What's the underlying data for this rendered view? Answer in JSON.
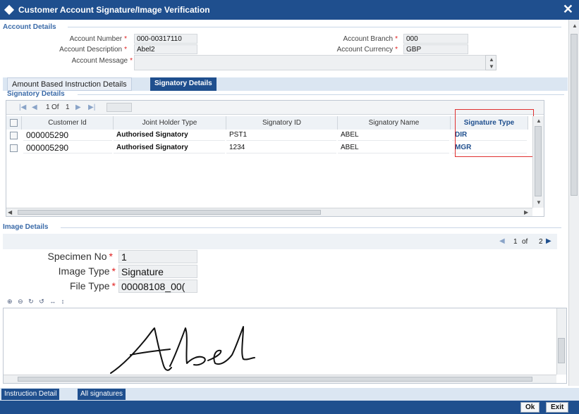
{
  "window": {
    "title": "Customer Account Signature/Image Verification"
  },
  "account_details": {
    "section_label": "Account Details",
    "account_number_label": "Account Number",
    "account_number": "000-00317110",
    "account_description_label": "Account Description",
    "account_description": "Abel2",
    "account_message_label": "Account Message",
    "account_message": "",
    "account_branch_label": "Account Branch",
    "account_branch": "000",
    "account_currency_label": "Account Currency",
    "account_currency": "GBP"
  },
  "tabs": [
    {
      "label": "Amount Based Instruction Details"
    },
    {
      "label": "Signatory Details"
    }
  ],
  "signatory": {
    "section_label": "Signatory Details",
    "pager": {
      "current": "1",
      "of_label": "Of",
      "total": "1"
    },
    "columns": [
      "Customer Id",
      "Joint Holder Type",
      "Signatory ID",
      "Signatory Name",
      "Signature Type"
    ],
    "rows": [
      {
        "customer_id": "000005290",
        "joint_holder_type": "Authorised Signatory",
        "signatory_id": "PST1",
        "signatory_name": "ABEL",
        "signature_type": "DIR"
      },
      {
        "customer_id": "000005290",
        "joint_holder_type": "Authorised Signatory",
        "signatory_id": "1234",
        "signatory_name": "ABEL",
        "signature_type": "MGR"
      }
    ]
  },
  "image_details": {
    "section_label": "Image Details",
    "pager": {
      "current": "1",
      "of_label": "of",
      "total": "2"
    },
    "specimen_no_label": "Specimen No",
    "specimen_no": "1",
    "image_type_label": "Image Type",
    "image_type": "Signature",
    "file_type_label": "File Type",
    "file_type": "00008108_00("
  },
  "bottom_tabs": [
    {
      "label": "Instruction Detail"
    },
    {
      "label": "All signatures"
    }
  ],
  "footer": {
    "ok_label": "Ok",
    "exit_label": "Exit"
  },
  "colors": {
    "brand": "#1f4f8e",
    "required": "#e02020",
    "highlight_box": "#e03030"
  }
}
